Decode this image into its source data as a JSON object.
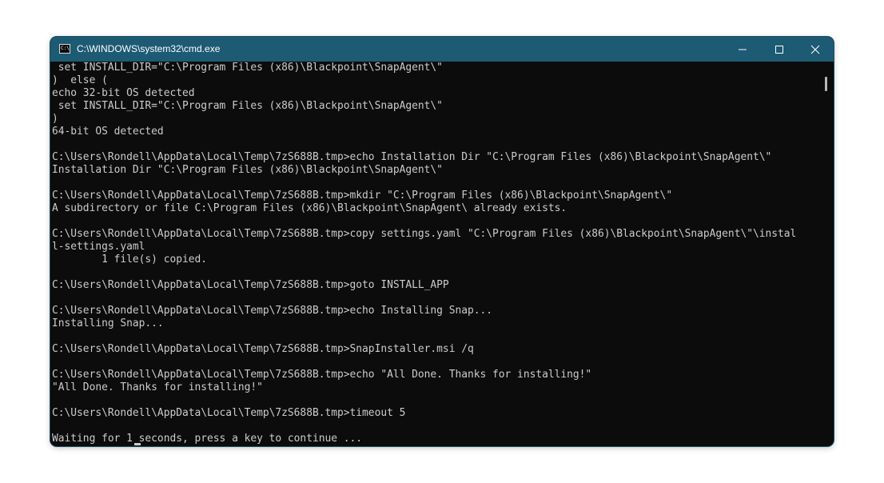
{
  "window": {
    "title": "C:\\WINDOWS\\system32\\cmd.exe",
    "icon": "cmd-app-icon",
    "controls": {
      "minimize_icon": "minimize-icon",
      "maximize_icon": "maximize-icon",
      "close_icon": "close-icon"
    }
  },
  "colors": {
    "titlebar": "#1d5a73",
    "terminal_background": "#0c0c0c",
    "terminal_text": "#cccccc"
  },
  "terminal": {
    "lines": [
      " set INSTALL_DIR=\"C:\\Program Files (x86)\\Blackpoint\\SnapAgent\\\"",
      ")  else (",
      "echo 32-bit OS detected",
      " set INSTALL_DIR=\"C:\\Program Files (x86)\\Blackpoint\\SnapAgent\\\"",
      ")",
      "64-bit OS detected",
      "",
      "C:\\Users\\Rondell\\AppData\\Local\\Temp\\7zS688B.tmp>echo Installation Dir \"C:\\Program Files (x86)\\Blackpoint\\SnapAgent\\\"",
      "Installation Dir \"C:\\Program Files (x86)\\Blackpoint\\SnapAgent\\\"",
      "",
      "C:\\Users\\Rondell\\AppData\\Local\\Temp\\7zS688B.tmp>mkdir \"C:\\Program Files (x86)\\Blackpoint\\SnapAgent\\\"",
      "A subdirectory or file C:\\Program Files (x86)\\Blackpoint\\SnapAgent\\ already exists.",
      "",
      "C:\\Users\\Rondell\\AppData\\Local\\Temp\\7zS688B.tmp>copy settings.yaml \"C:\\Program Files (x86)\\Blackpoint\\SnapAgent\\\"\\instal",
      "l-settings.yaml",
      "        1 file(s) copied.",
      "",
      "C:\\Users\\Rondell\\AppData\\Local\\Temp\\7zS688B.tmp>goto INSTALL_APP",
      "",
      "C:\\Users\\Rondell\\AppData\\Local\\Temp\\7zS688B.tmp>echo Installing Snap...",
      "Installing Snap...",
      "",
      "C:\\Users\\Rondell\\AppData\\Local\\Temp\\7zS688B.tmp>SnapInstaller.msi /q",
      "",
      "C:\\Users\\Rondell\\AppData\\Local\\Temp\\7zS688B.tmp>echo \"All Done. Thanks for installing!\"",
      "\"All Done. Thanks for installing!\"",
      "",
      "C:\\Users\\Rondell\\AppData\\Local\\Temp\\7zS688B.tmp>timeout 5",
      "",
      "Waiting for 1 seconds, press a key to continue ..."
    ]
  }
}
